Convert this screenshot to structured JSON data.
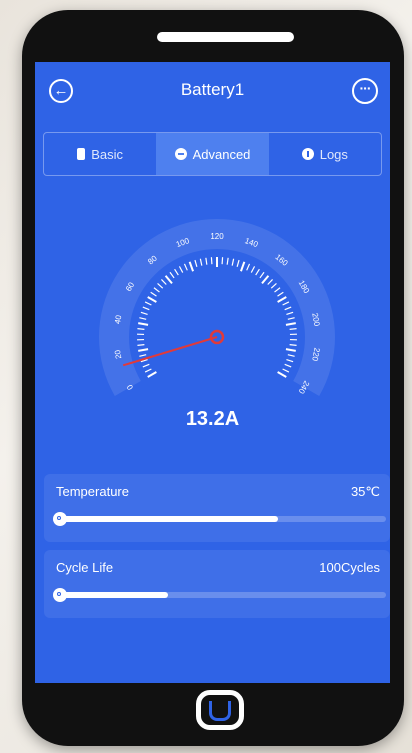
{
  "header": {
    "title": "Battery1",
    "back_icon": "back-arrow-icon",
    "more_icon": "more-dots-icon"
  },
  "tabs": [
    {
      "label": "Basic",
      "icon": "battery-icon",
      "active": false
    },
    {
      "label": "Advanced",
      "icon": "minus-circle-icon",
      "active": true
    },
    {
      "label": "Logs",
      "icon": "info-circle-icon",
      "active": false
    }
  ],
  "gauge": {
    "ticks": [
      "0",
      "20",
      "40",
      "60",
      "80",
      "100",
      "120",
      "140",
      "160",
      "180",
      "200",
      "220",
      "240"
    ],
    "min": 0,
    "max": 240,
    "value": 13.2,
    "value_text": "13.2A",
    "needle_color": "#e03a3a"
  },
  "cards": {
    "temperature": {
      "label": "Temperature",
      "value": "35℃",
      "level": 0.67
    },
    "cycle_life": {
      "label": "Cycle Life",
      "value": "100Cycles",
      "level": 0.33
    }
  },
  "colors": {
    "screen_bg": "#2f63e6",
    "active_tab": "#4e80ef"
  }
}
